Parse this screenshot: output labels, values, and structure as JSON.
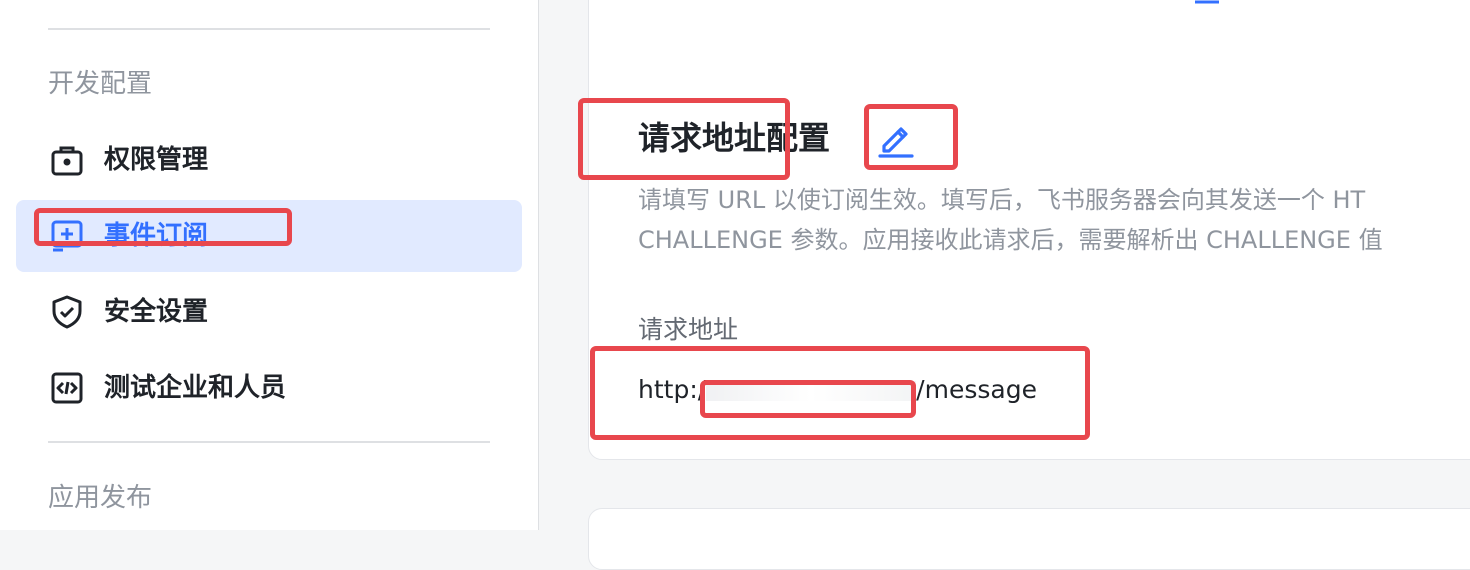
{
  "sidebar": {
    "sections": [
      {
        "title": "开发配置",
        "items": [
          {
            "label": "权限管理",
            "icon": "briefcase-lock-icon",
            "active": false
          },
          {
            "label": "事件订阅",
            "icon": "add-box-icon",
            "active": true
          },
          {
            "label": "安全设置",
            "icon": "shield-check-icon",
            "active": false
          },
          {
            "label": "测试企业和人员",
            "icon": "code-box-icon",
            "active": false
          }
        ]
      },
      {
        "title": "应用发布"
      }
    ]
  },
  "main": {
    "heading": "请求地址配置",
    "description_lines": [
      "请填写 URL 以使订阅生效。填写后，飞书服务器会向其发送一个 HT",
      "CHALLENGE 参数。应用接收此请求后，需要解析出 CHALLENGE 值"
    ],
    "field_label": "请求地址",
    "url_prefix": "http:/",
    "url_suffix": "/message"
  },
  "colors": {
    "accent": "#3370ff",
    "active_bg": "#e1eaff",
    "annotation": "#e8474d"
  }
}
